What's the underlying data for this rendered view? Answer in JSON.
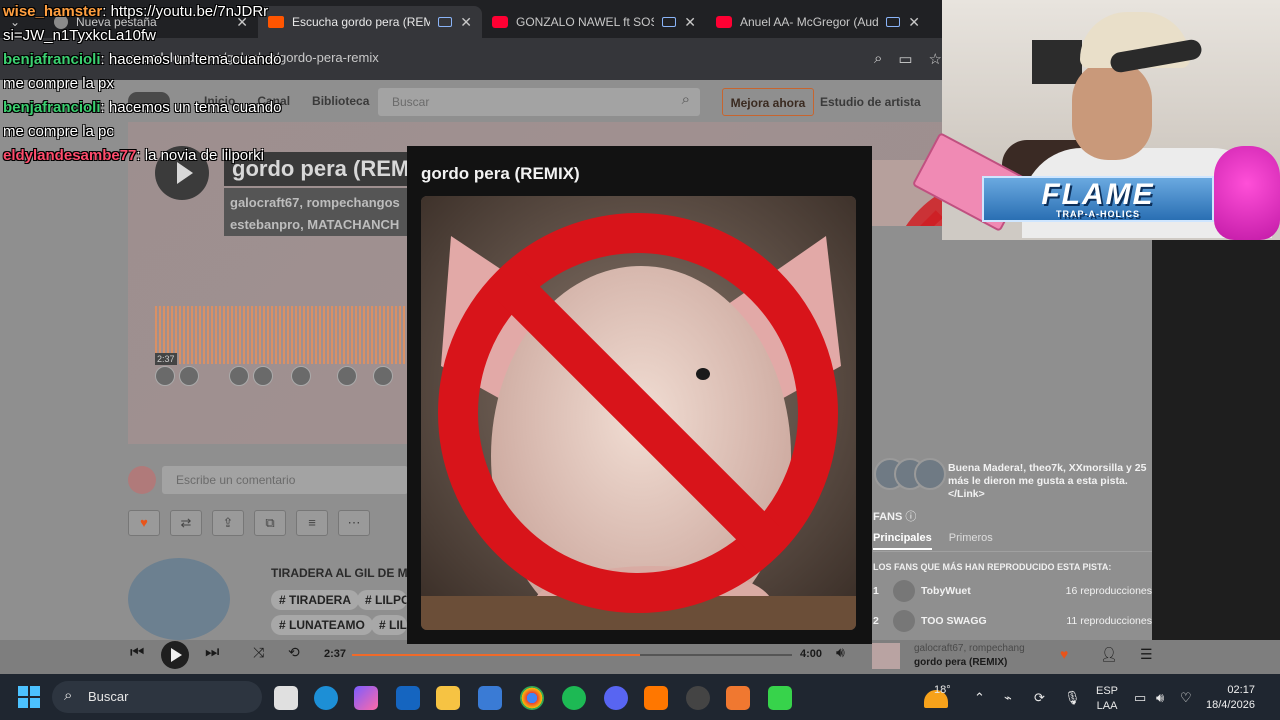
{
  "browser": {
    "tabs": [
      {
        "title": "Nueva pestaña",
        "icon": "generic-tab-icon",
        "active": false
      },
      {
        "title": "Escucha gordo pera (REMIX",
        "icon": "soundcloud-icon",
        "active": true
      },
      {
        "title": "GONZALO NAWEL ft SOSSA",
        "icon": "youtube-icon",
        "active": false
      },
      {
        "title": "Anuel AA- McGregor (Audi",
        "icon": "youtube-icon",
        "active": false
      }
    ],
    "url_host": "soundcloud.com",
    "url_path": "/galoplug/gordo-pera-remix"
  },
  "soundcloud": {
    "nav": {
      "home": "Inicio",
      "feed": "Canal",
      "library": "Biblioteca",
      "search_placeholder": "Buscar",
      "upgrade": "Mejora ahora",
      "studio": "Estudio de artista"
    },
    "track": {
      "title": "gordo pera (REMIX)",
      "artists_line1": "galocraft67, rompechangos",
      "artists_line2": "estebanpro, MATACHANCH",
      "elapsed": "2:37"
    },
    "comment_placeholder": "Escribe un comentario",
    "related": {
      "title": "TIRADERA AL GIL DE MIE",
      "tags": [
        "# TIRADERA",
        "# LILPO",
        "# LUNATEAMO",
        "# LIL"
      ]
    },
    "likes_text": "Buena Madera!, theo7k, XXmorsilla y 25 más le dieron me gusta a esta pista.</Link>",
    "fans": {
      "heading": "FANS",
      "tab_top": "Principales",
      "tab_first": "Primeros",
      "subheading": "LOS FANS QUE MÁS HAN REPRODUCIDO ESTA PISTA:",
      "list": [
        {
          "rank": "1",
          "name": "TobyWuet",
          "plays": "16 reproducciones"
        },
        {
          "rank": "2",
          "name": "TOO SWAGG",
          "plays": "11 reproducciones"
        }
      ]
    }
  },
  "player": {
    "elapsed": "2:37",
    "duration": "4:00",
    "progress_fraction": 0.654,
    "now_artist": "galocraft67, rompechang",
    "now_title": "gordo pera (REMIX)"
  },
  "modal": {
    "title": "gordo pera (REMIX)",
    "image": "pig-with-prohibition-sign"
  },
  "chat": [
    {
      "user": "wise_hamster",
      "text": "https://youtu.be/7nJDRr si=JW_n1TyxkcLa10fw"
    },
    {
      "user": "benjafrancioli",
      "text": "hacemos un tema cuando me compre la px"
    },
    {
      "user": "benjafrancioli",
      "text": "hacemos un tema cuando me compre la pc"
    },
    {
      "user": "eldylandesambe77",
      "text": "la novia de lilporki"
    }
  ],
  "overlay": {
    "brand": "FLAME",
    "brand_sub": "TRAP-A-HOLICS"
  },
  "taskbar": {
    "search_label": "Buscar",
    "temperature": "18°",
    "language": "ESP",
    "region": "LAA",
    "time": "02:17",
    "date": "18/4/2026"
  },
  "colors": {
    "accent": "#ff5500",
    "prohibition_red": "#d8141a",
    "chat_user_orange": "#ff9f40",
    "chat_user_green": "#3cd070",
    "chat_user_red": "#ff4d6d"
  }
}
